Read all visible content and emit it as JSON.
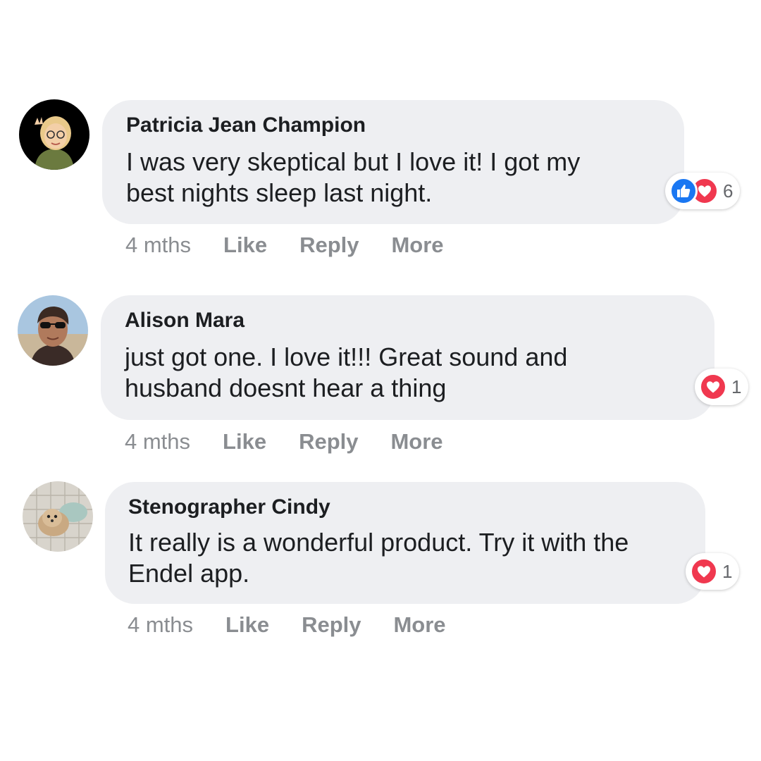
{
  "comments": [
    {
      "author": "Patricia Jean Champion",
      "text_line1": "I was very skeptical but I love it! I got my",
      "text_line2": "best nights sleep last night.",
      "time": "4 mths",
      "like_label": "Like",
      "reply_label": "Reply",
      "more_label": "More",
      "reactions": [
        "like-icon",
        "love-icon"
      ],
      "reaction_count": "6"
    },
    {
      "author": "Alison Mara",
      "text_line1": "just got one. I love it!!! Great sound and",
      "text_line2": "husband doesnt hear a thing",
      "time": "4 mths",
      "like_label": "Like",
      "reply_label": "Reply",
      "more_label": "More",
      "reactions": [
        "love-icon"
      ],
      "reaction_count": "1"
    },
    {
      "author": "Stenographer Cindy",
      "text_line1": "It really is a wonderful product. Try it with the",
      "text_line2": "Endel app.",
      "time": "4 mths",
      "like_label": "Like",
      "reply_label": "Reply",
      "more_label": "More",
      "reactions": [
        "love-icon"
      ],
      "reaction_count": "1"
    }
  ],
  "colors": {
    "bubble": "#eeeff2",
    "text": "#1c1e21",
    "meta": "#8a8d91",
    "like_blue": "#1a77f2",
    "love_red": "#f0384f"
  }
}
